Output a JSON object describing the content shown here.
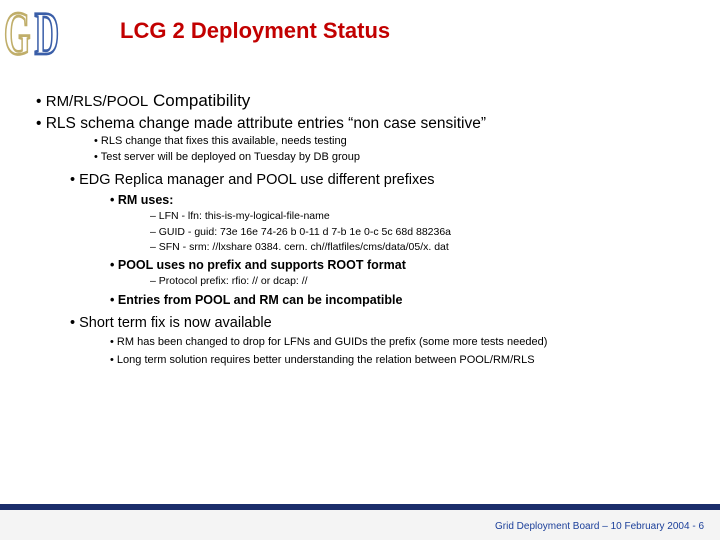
{
  "logo": {
    "g": "G",
    "d": "D"
  },
  "title": "LCG 2 Deployment Status",
  "b1_lead": "RM/RLS/POOL",
  "b1_rest": " Compatibility",
  "b2": "RLS schema change made attribute entries “non case sensitive”",
  "b2_s1": "RLS change that fixes this available, needs testing",
  "b2_s2": "Test server will be deployed on Tuesday by DB group",
  "b3": "EDG Replica manager and POOL use different prefixes",
  "b3_rm": "RM uses:",
  "b3_rm_lfn": "LFN - lfn: this-is-my-logical-file-name",
  "b3_rm_guid": "GUID - guid: 73e 16e 74-26 b 0-11 d 7-b 1e 0-c 5c 68d 88236a",
  "b3_rm_sfn": "SFN - srm: //lxshare 0384. cern. ch//flatfiles/cms/data/05/x. dat",
  "b3_pool": "POOL uses no prefix and supports ROOT format",
  "b3_pool_proto": "Protocol prefix: rfio: // or dcap: //",
  "b3_entries": "Entries from POOL and RM can be incompatible",
  "b4": "Short term fix is now available",
  "b4_s1": "RM has been changed to drop for LFNs and GUIDs the prefix (some more tests needed)",
  "b4_s2": "Long term solution requires better understanding the relation between POOL/RM/RLS",
  "footer": "Grid Deployment Board – 10 February 2004 - 6"
}
